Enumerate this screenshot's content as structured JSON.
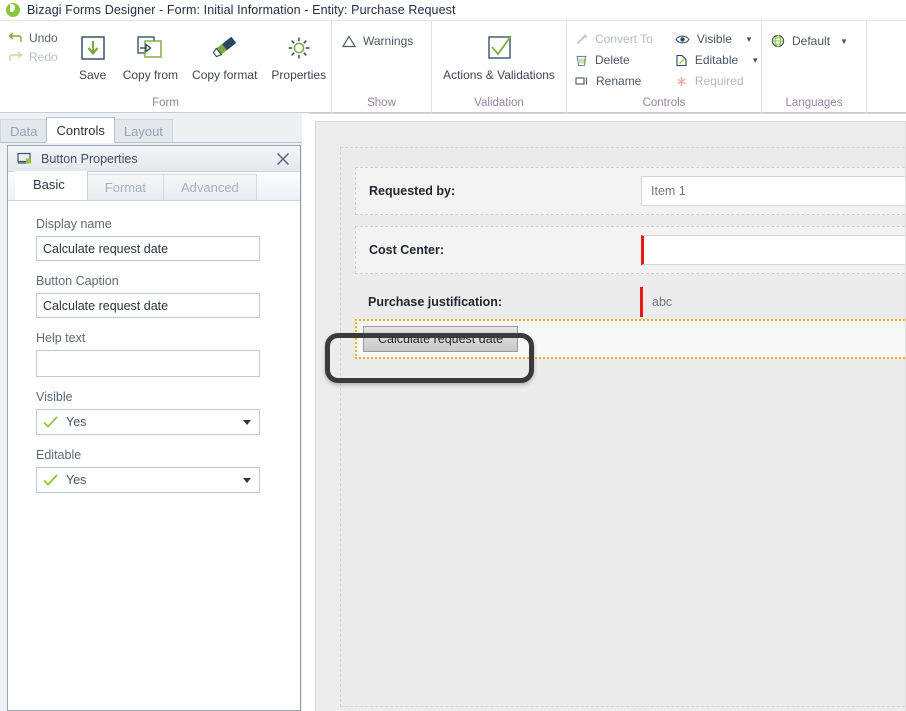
{
  "window": {
    "logo_icon": "bizagi-logo-icon",
    "title": "Bizagi Forms Designer  - Form: Initial Information - Entity:  Purchase Request"
  },
  "ribbon": {
    "groups": [
      {
        "label": "Form",
        "quick": [
          {
            "label": "Undo",
            "icon": "undo-icon",
            "disabled": false
          },
          {
            "label": "Redo",
            "icon": "redo-icon",
            "disabled": true
          }
        ],
        "buttons": [
          {
            "label": "Save",
            "icon": "save-icon"
          },
          {
            "label": "Copy from",
            "icon": "copy-from-icon"
          },
          {
            "label": "Copy format",
            "icon": "copy-format-icon"
          },
          {
            "label": "Properties",
            "icon": "gear-icon"
          }
        ]
      },
      {
        "label": "Show",
        "items": [
          {
            "label": "Warnings",
            "icon": "warning-triangle-icon",
            "disabled": false
          }
        ]
      },
      {
        "label": "Validation",
        "buttons": [
          {
            "label": "Actions & Validations",
            "icon": "checkbox-check-icon"
          }
        ]
      },
      {
        "label": "Controls",
        "items": [
          {
            "label": "Convert To",
            "icon": "convert-to-icon",
            "disabled": true,
            "caret": false
          },
          {
            "label": "Delete",
            "icon": "trash-icon",
            "disabled": false,
            "caret": false
          },
          {
            "label": "Rename",
            "icon": "rename-icon",
            "disabled": false,
            "caret": false
          },
          {
            "label": "Visible",
            "icon": "eye-icon",
            "disabled": false,
            "caret": true
          },
          {
            "label": "Editable",
            "icon": "edit-pencil-icon",
            "disabled": false,
            "caret": true
          },
          {
            "label": "Required",
            "icon": "asterisk-icon",
            "disabled": true,
            "caret": false
          }
        ]
      },
      {
        "label": "Languages",
        "items": [
          {
            "label": "Default",
            "icon": "globe-icon",
            "disabled": false,
            "caret": true
          }
        ]
      }
    ]
  },
  "left_panel": {
    "tabs": [
      {
        "label": "Data",
        "active": false
      },
      {
        "label": "Controls",
        "active": true
      },
      {
        "label": "Layout",
        "active": false
      }
    ],
    "properties": {
      "icon": "button-control-icon",
      "title": "Button Properties",
      "close_icon": "close-icon",
      "tabs": [
        {
          "label": "Basic",
          "active": true
        },
        {
          "label": "Format",
          "active": false
        },
        {
          "label": "Advanced",
          "active": false
        }
      ],
      "fields": {
        "display_name": {
          "label": "Display name",
          "value": "Calculate request date",
          "placeholder": ""
        },
        "button_caption": {
          "label": "Button Caption",
          "value": "Calculate request date",
          "placeholder": ""
        },
        "help_text": {
          "label": "Help text",
          "value": "",
          "placeholder": ""
        },
        "visible": {
          "label": "Visible",
          "value": "Yes",
          "icon": "check-icon"
        },
        "editable": {
          "label": "Editable",
          "value": "Yes",
          "icon": "check-icon"
        }
      }
    }
  },
  "canvas": {
    "rows": [
      {
        "label": "Requested by:",
        "value": "Item 1",
        "required": false,
        "style": "boxed"
      },
      {
        "label": "Cost Center:",
        "value": "",
        "required": true,
        "style": "boxed"
      },
      {
        "label": "Purchase justification:",
        "value": "abc",
        "required": true,
        "style": "plain"
      }
    ],
    "button_row": {
      "caption": "Calculate request date",
      "selected": true,
      "selection_color": "#f0b323",
      "highlight_color": "#3a3a3a"
    }
  }
}
